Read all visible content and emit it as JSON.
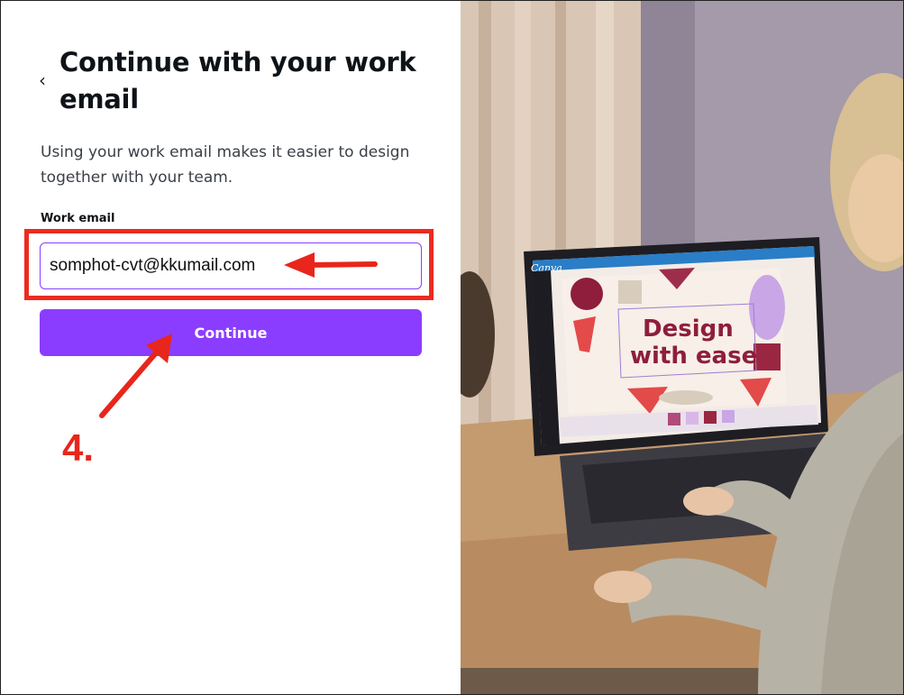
{
  "header": {
    "back_glyph": "‹",
    "title": "Continue with your work email"
  },
  "subtitle": "Using your work email makes it easier to design together with your team.",
  "form": {
    "email_label": "Work email",
    "email_value": "somphot-cvt@kkumail.com",
    "continue_label": "Continue"
  },
  "annotation": {
    "step_label": "4.",
    "color": "#e8261b"
  },
  "hero": {
    "app_logo": "Canva",
    "slide_text_line1": "Design",
    "slide_text_line2": "with ease"
  },
  "colors": {
    "accent": "#8b3dff",
    "text": "#0e1318",
    "highlight": "#ec2b1f"
  }
}
